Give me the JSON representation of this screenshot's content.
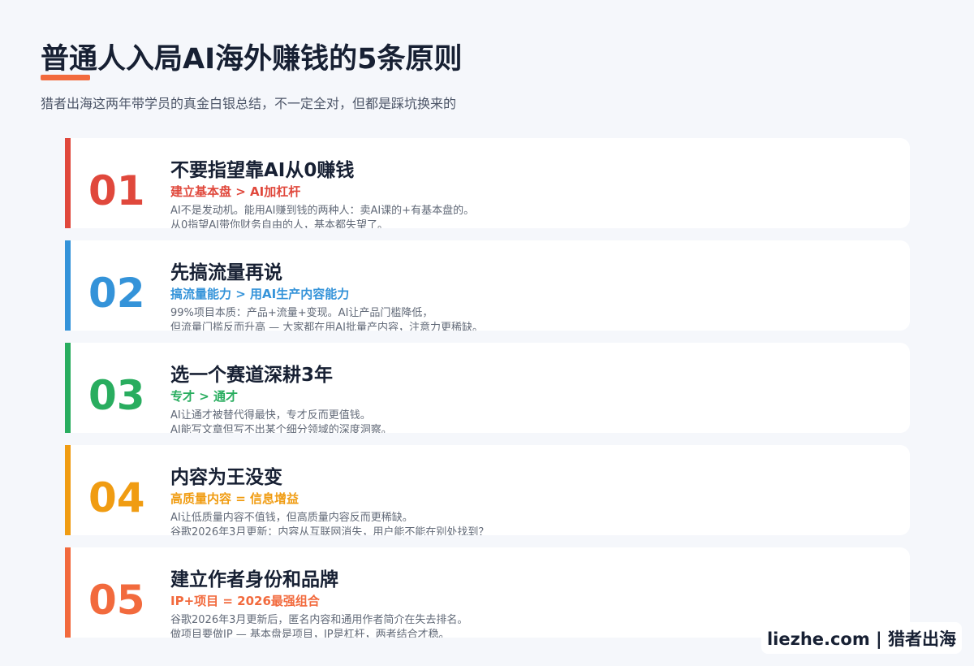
{
  "header": {
    "title": "普通人入局AI海外赚钱的5条原则",
    "subtitle": "猎者出海这两年带学员的真金白银总结，不一定全对，但都是踩坑换来的"
  },
  "principles": [
    {
      "number": "01",
      "title": "不要指望靠AI从0赚钱",
      "tagline": "建立基本盘 > AI加杠杆",
      "desc_line1": "AI不是发动机。能用AI赚到钱的两种人：卖AI课的+有基本盘的。",
      "desc_line2": "从0指望AI带你财务自由的人，基本都失望了。",
      "color": "#e0483c"
    },
    {
      "number": "02",
      "title": "先搞流量再说",
      "tagline": "搞流量能力 > 用AI生产内容能力",
      "desc_line1": "99%项目本质：产品+流量+变现。AI让产品门槛降低，",
      "desc_line2": "但流量门槛反而升高 — 大家都在用AI批量产内容，注意力更稀缺。",
      "color": "#3493d9"
    },
    {
      "number": "03",
      "title": "选一个赛道深耕3年",
      "tagline": "专才 > 通才",
      "desc_line1": "AI让通才被替代得最快，专才反而更值钱。",
      "desc_line2": "AI能写文章但写不出某个细分领域的深度洞察。",
      "color": "#29ad5f"
    },
    {
      "number": "04",
      "title": "内容为王没变",
      "tagline": "高质量内容 = 信息增益",
      "desc_line1": "AI让低质量内容不值钱，但高质量内容反而更稀缺。",
      "desc_line2": "谷歌2026年3月更新：内容从互联网消失，用户能不能在别处找到？",
      "color": "#f09c12"
    },
    {
      "number": "05",
      "title": "建立作者身份和品牌",
      "tagline": "IP+项目 = 2026最强组合",
      "desc_line1": "谷歌2026年3月更新后，匿名内容和通用作者简介在失去排名。",
      "desc_line2": "做项目要做IP — 基本盘是项目，IP是杠杆，两者结合才稳。",
      "color": "#f26a3d"
    }
  ],
  "footer": {
    "watermark": "liezhe.com | 猎者出海"
  },
  "accent_color": "#f26a3d"
}
